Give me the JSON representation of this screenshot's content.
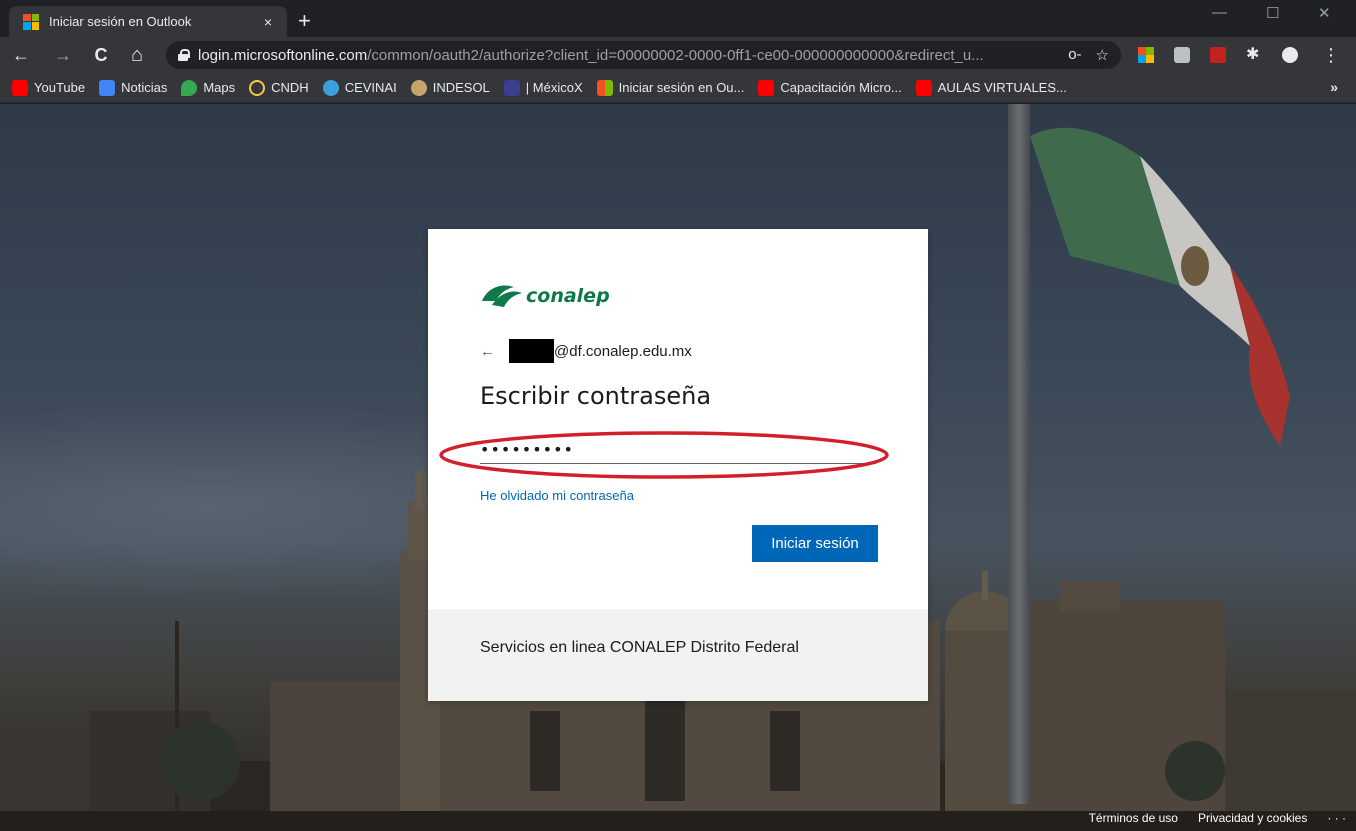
{
  "browser": {
    "tab": {
      "title": "Iniciar sesión en Outlook",
      "close_glyph": "×",
      "favicon_colors": [
        "#f25022",
        "#7fba00",
        "#00a4ef",
        "#ffb900"
      ]
    },
    "new_tab_glyph": "+",
    "window_controls": {
      "minimize": "—",
      "maximize": "☐",
      "close": "✕"
    },
    "nav": {
      "back": "←",
      "forward": "→",
      "reload": "C",
      "home": "⌂"
    },
    "address": {
      "host": "login.microsoftonline.com",
      "path": "/common/oauth2/authorize?client_id=00000002-0000-0ff1-ce00-000000000000&redirect_u...",
      "key_icon": "o-",
      "star_icon": "☆"
    },
    "extensions": [
      "colors-ext-icon",
      "camera-ext-icon",
      "pdf-ext-icon",
      "puzzle-icon",
      "profile-icon",
      "menu-icon"
    ],
    "bookmarks": [
      {
        "label": "YouTube",
        "icon": "youtube-icon",
        "color": "#ff0000"
      },
      {
        "label": "Noticias",
        "icon": "news-icon",
        "color": "#4285f4"
      },
      {
        "label": "Maps",
        "icon": "maps-icon",
        "color": "#34a853"
      },
      {
        "label": "CNDH",
        "icon": "cndh-icon",
        "color": "#f2c94c"
      },
      {
        "label": "CEVINAI",
        "icon": "edge-icon",
        "color": "#3aa1dc"
      },
      {
        "label": "INDESOL",
        "icon": "circle-icon",
        "color": "#c8a46a"
      },
      {
        "label": "| MéxicoX",
        "icon": "mexicox-icon",
        "color": "#3b3f8f"
      },
      {
        "label": "Iniciar sesión en Ou...",
        "icon": "microsoft-icon",
        "color": "#f25022"
      },
      {
        "label": "Capacitación Micro...",
        "icon": "youtube-icon",
        "color": "#ff0000"
      },
      {
        "label": "AULAS VIRTUALES...",
        "icon": "youtube-icon",
        "color": "#ff0000"
      }
    ],
    "bookmarks_more": "»"
  },
  "login": {
    "logo_text": "conalep",
    "brand_color": "#0e7a48",
    "back_glyph": "←",
    "email_domain": "@df.conalep.edu.mx",
    "heading": "Escribir contraseña",
    "password_value": "•••••••••",
    "forgot_link": "He olvidado mi contraseña",
    "signin_button": "Iniciar sesión",
    "accent_color": "#0067b8",
    "footer_text": "Servicios en linea CONALEP Distrito Federal",
    "annotation_color": "#d21f2b"
  },
  "page_footer": {
    "terms": "Términos de uso",
    "privacy": "Privacidad y cookies",
    "more": "· · ·"
  }
}
